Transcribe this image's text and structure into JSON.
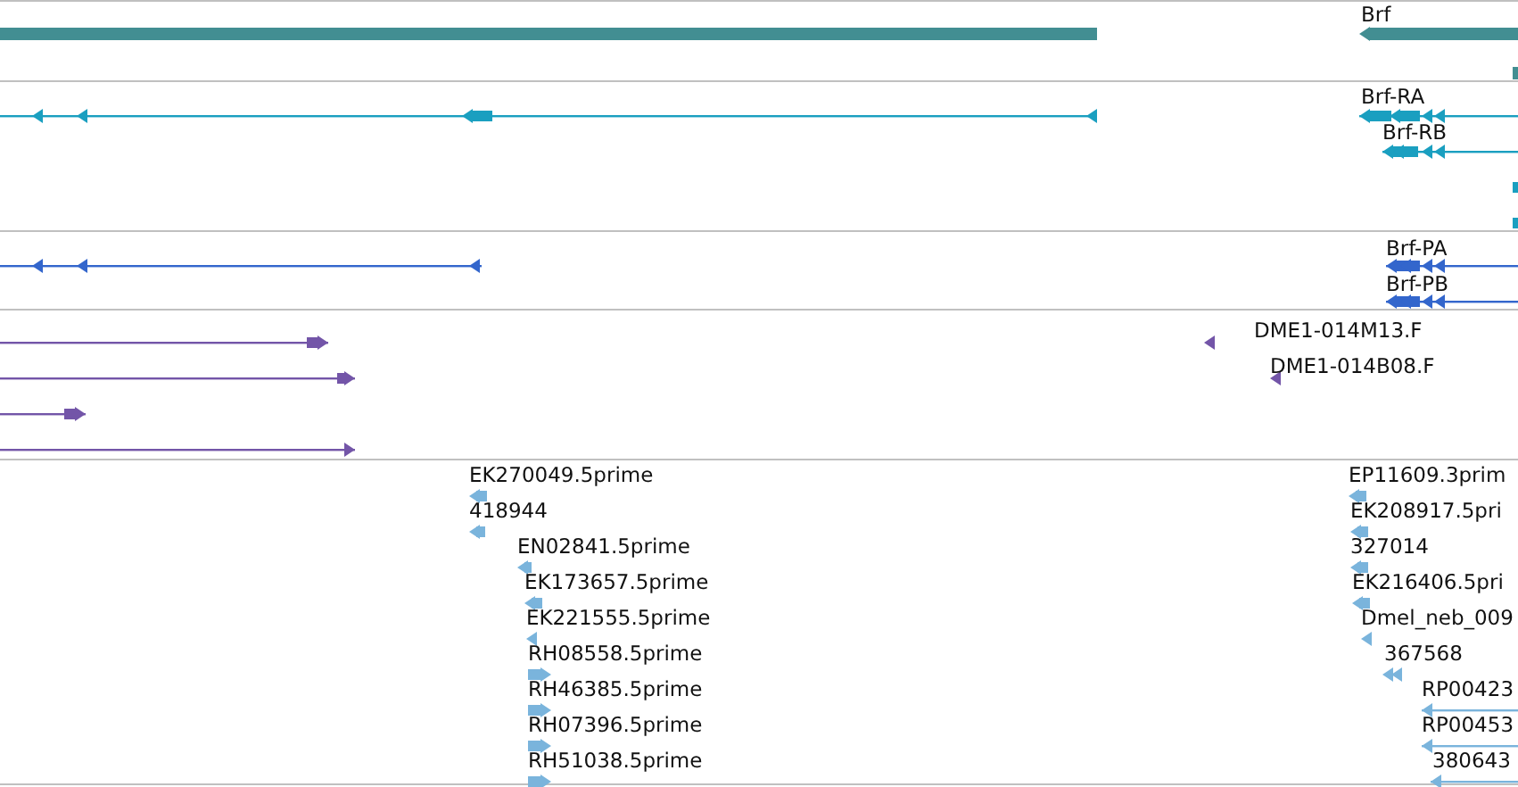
{
  "tracks": [
    {
      "kind": "gene",
      "features": [
        {
          "kind": "block"
        },
        {
          "kind": "arrow",
          "label": "Brf",
          "forward": false
        },
        {
          "kind": "block"
        }
      ]
    },
    {
      "kind": "transcript",
      "features": [
        {
          "kind": "arrow",
          "forward": false
        },
        {
          "kind": "arrow",
          "label": "Brf-RA",
          "forward": false
        },
        {
          "kind": "arrow",
          "label": "Brf-RB",
          "forward": false
        },
        {
          "kind": "block"
        },
        {
          "kind": "block"
        }
      ]
    },
    {
      "kind": "protein",
      "features": [
        {
          "kind": "arrow",
          "forward": false
        },
        {
          "kind": "arrow",
          "label": "Brf-PA",
          "forward": false
        },
        {
          "kind": "arrow",
          "label": "Brf-PB",
          "forward": false
        }
      ]
    },
    {
      "kind": "clone",
      "features": [
        {
          "kind": "arrow",
          "forward": true
        },
        {
          "kind": "arrow",
          "forward": true
        },
        {
          "kind": "arrow",
          "forward": true
        },
        {
          "kind": "arrow",
          "forward": true
        },
        {
          "kind": "arrow",
          "label": "DME1-014M13.F",
          "forward": false
        },
        {
          "kind": "arrow",
          "label": "DME1-014B08.F",
          "forward": false
        }
      ]
    },
    {
      "kind": "est",
      "features": [
        {
          "kind": "arrow",
          "label": "EK270049.5prime",
          "forward": false
        },
        {
          "kind": "arrow",
          "label": "418944",
          "forward": false
        },
        {
          "kind": "arrow",
          "label": "EN02841.5prime",
          "forward": false
        },
        {
          "kind": "arrow",
          "label": "EK173657.5prime",
          "forward": false
        },
        {
          "kind": "arrow",
          "label": "EK221555.5prime",
          "forward": false
        },
        {
          "kind": "arrow",
          "label": "RH08558.5prime",
          "forward": true
        },
        {
          "kind": "arrow",
          "label": "RH46385.5prime",
          "forward": true
        },
        {
          "kind": "arrow",
          "label": "RH07396.5prime",
          "forward": true
        },
        {
          "kind": "arrow",
          "label": "RH51038.5prime",
          "forward": true
        },
        {
          "kind": "arrow",
          "label": "EP11609.3prim",
          "forward": false
        },
        {
          "kind": "arrow",
          "label": "EK208917.5pri",
          "forward": false
        },
        {
          "kind": "arrow",
          "label": "327014",
          "forward": false
        },
        {
          "kind": "arrow",
          "label": "EK216406.5pri",
          "forward": false
        },
        {
          "kind": "arrow",
          "label": "Dmel_neb_009",
          "forward": false
        },
        {
          "kind": "arrow",
          "label": "367568",
          "forward": false
        },
        {
          "kind": "arrow",
          "label": "RP00423",
          "forward": false
        },
        {
          "kind": "arrow",
          "label": "RP00453",
          "forward": false
        },
        {
          "kind": "arrow",
          "label": "380643",
          "forward": false
        }
      ]
    }
  ]
}
